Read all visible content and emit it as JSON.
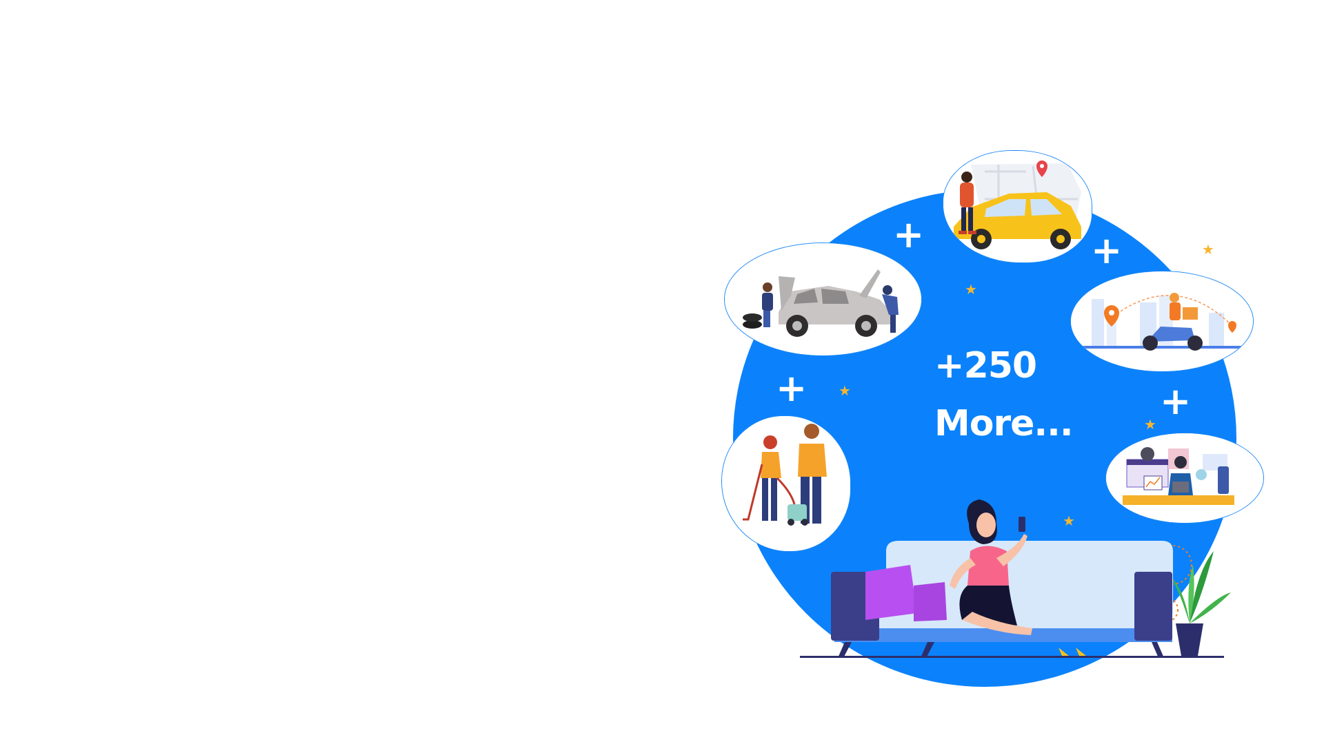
{
  "headline": {
    "count": "+250",
    "more": "More..."
  },
  "colors": {
    "circle": "#0b82fb",
    "bubble_border": "#1b86f6",
    "star": "#f6b630",
    "plus": "#ffffff"
  },
  "illustrations": [
    {
      "icon": "car-mechanic-illustration"
    },
    {
      "icon": "taxi-ride-illustration"
    },
    {
      "icon": "scooter-delivery-illustration"
    },
    {
      "icon": "cleaning-service-illustration"
    },
    {
      "icon": "tech-support-illustration"
    },
    {
      "icon": "woman-on-sofa-illustration"
    }
  ]
}
